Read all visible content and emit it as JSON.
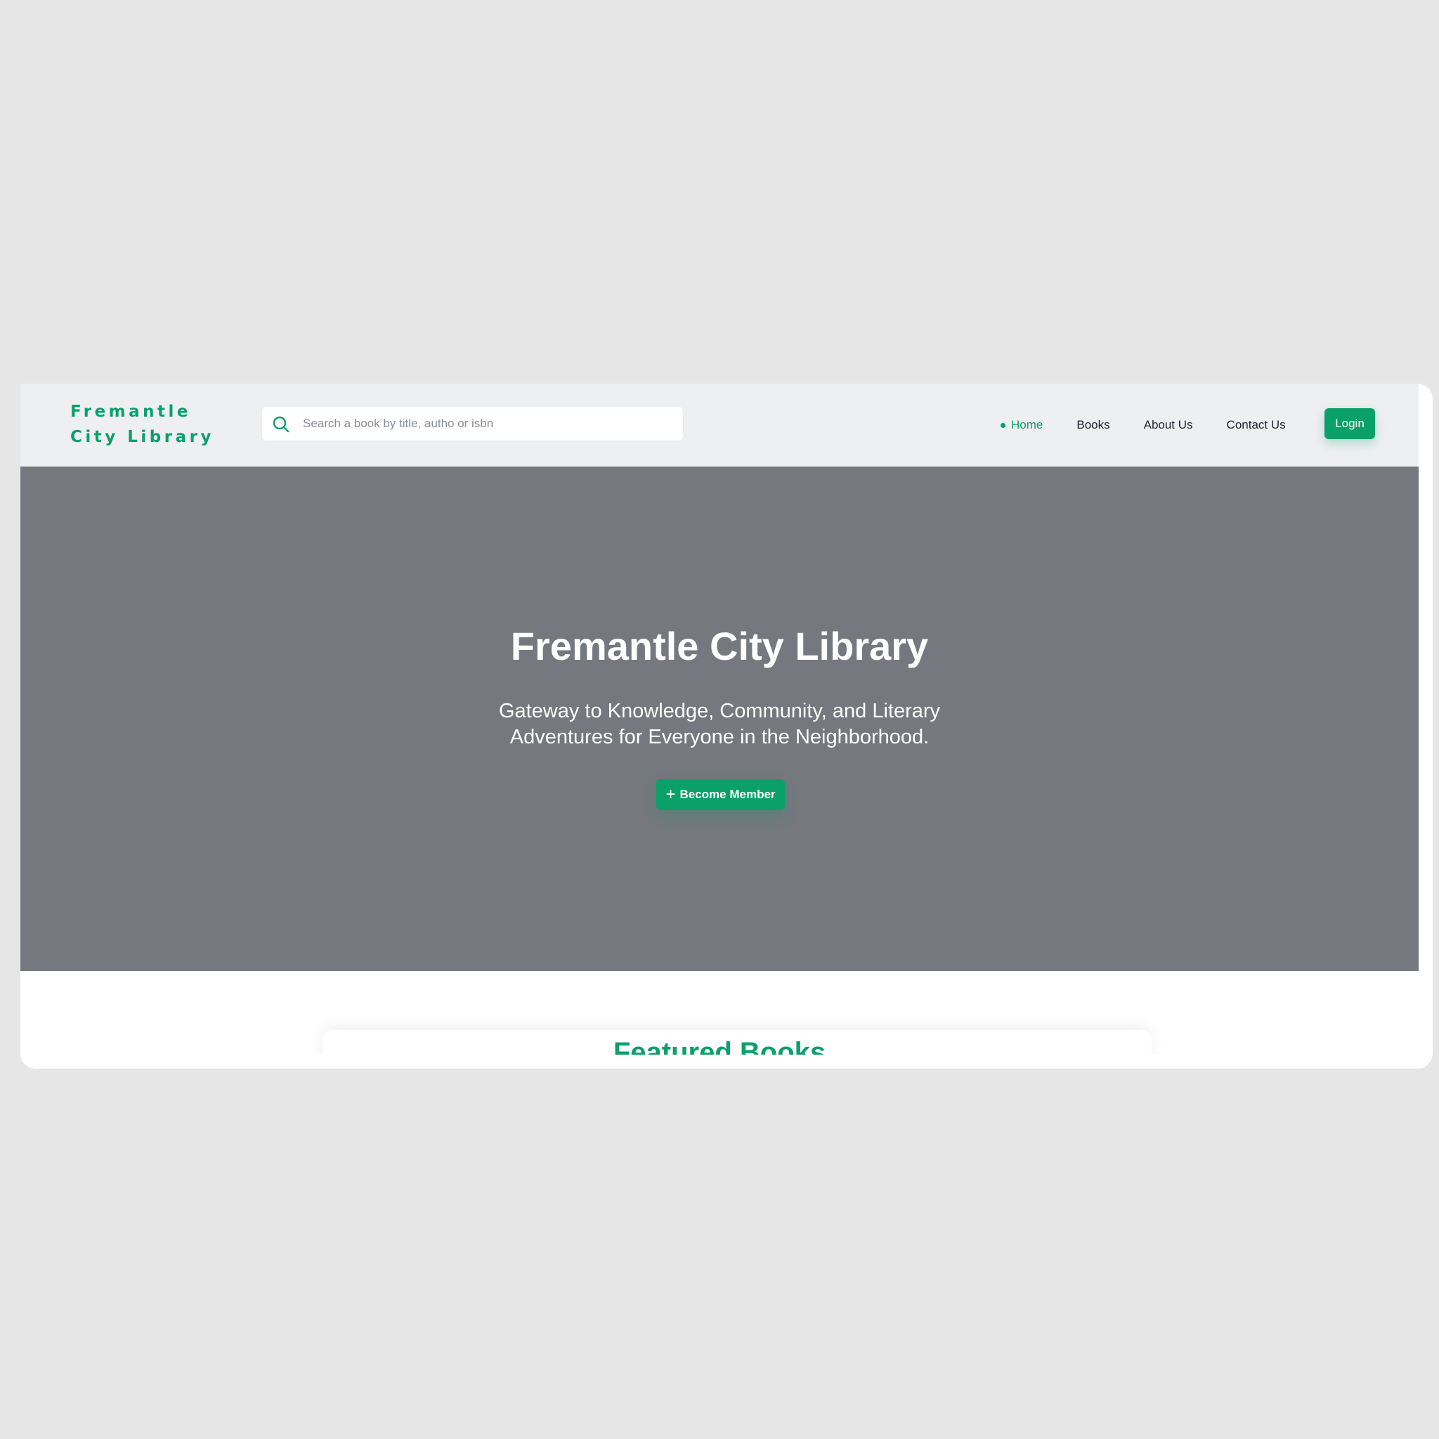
{
  "brand": {
    "name": "Fremantle City Library"
  },
  "search": {
    "placeholder": "Search a book by title, autho or isbn",
    "icon": "search-icon"
  },
  "nav": {
    "items": [
      {
        "label": "Home",
        "active": true
      },
      {
        "label": "Books",
        "active": false
      },
      {
        "label": "About Us",
        "active": false
      },
      {
        "label": "Contact Us",
        "active": false
      }
    ],
    "login_label": "Login"
  },
  "hero": {
    "title": "Fremantle City Library",
    "subtitle": "Gateway to Knowledge, Community, and Literary Adventures for Everyone in the Neighborhood.",
    "cta_label": "Become Member",
    "cta_icon": "plus-icon"
  },
  "featured": {
    "title": "Featured Books"
  },
  "colors": {
    "accent": "#0aa06a",
    "hero_bg": "#75787e",
    "nav_bg": "#eeeff1",
    "page_bg": "#e6e6e7"
  }
}
